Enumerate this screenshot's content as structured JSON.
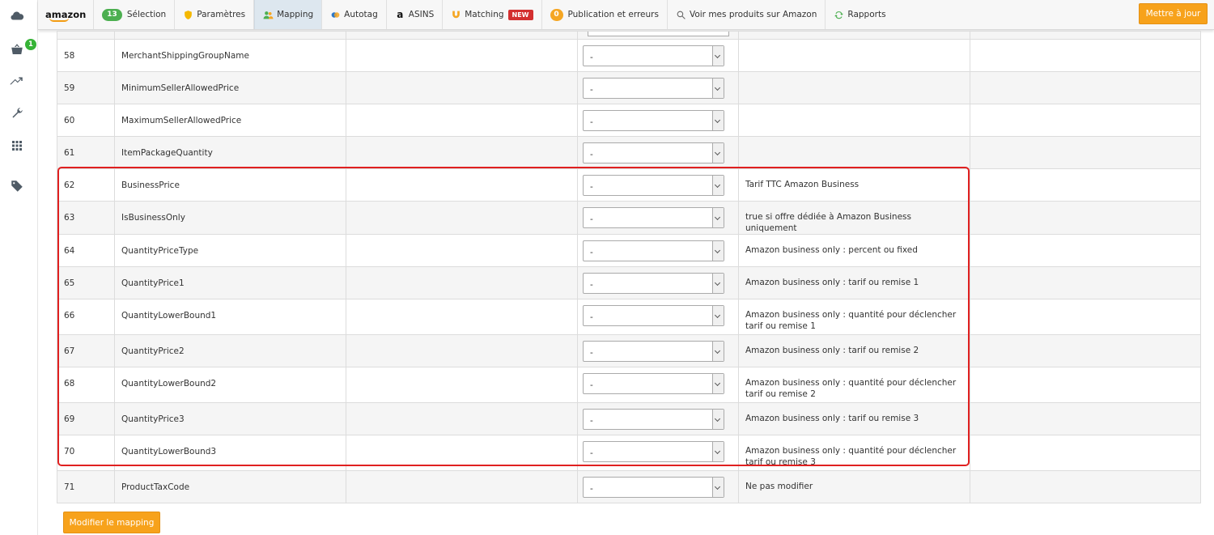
{
  "nav": {
    "logo": "amazon",
    "selection": {
      "count": "13",
      "label": "Sélection"
    },
    "parametres": "Paramètres",
    "mapping": "Mapping",
    "autotag": "Autotag",
    "asins": "ASINS",
    "matching": {
      "label": "Matching",
      "badge": "NEW"
    },
    "publication": {
      "count": "0",
      "label": "Publication et erreurs"
    },
    "voir": "Voir mes produits sur Amazon",
    "rapports": "Rapports",
    "update_label": "Mettre à jour"
  },
  "sidebar": {
    "cart_badge": "1"
  },
  "rows": [
    {
      "num": "58",
      "field": "MerchantShippingGroupName",
      "select": "-",
      "desc": "",
      "tall": false
    },
    {
      "num": "59",
      "field": "MinimumSellerAllowedPrice",
      "select": "-",
      "desc": "",
      "tall": false
    },
    {
      "num": "60",
      "field": "MaximumSellerAllowedPrice",
      "select": "-",
      "desc": "",
      "tall": false
    },
    {
      "num": "61",
      "field": "ItemPackageQuantity",
      "select": "-",
      "desc": "",
      "tall": false
    },
    {
      "num": "62",
      "field": "BusinessPrice",
      "select": "-",
      "desc": "Tarif TTC Amazon Business",
      "tall": false
    },
    {
      "num": "63",
      "field": "IsBusinessOnly",
      "select": "-",
      "desc": "true si offre dédiée à Amazon Business uniquement",
      "tall": false
    },
    {
      "num": "64",
      "field": "QuantityPriceType",
      "select": "-",
      "desc": "Amazon business only : percent ou fixed",
      "tall": false
    },
    {
      "num": "65",
      "field": "QuantityPrice1",
      "select": "-",
      "desc": "Amazon business only : tarif ou remise 1",
      "tall": false
    },
    {
      "num": "66",
      "field": "QuantityLowerBound1",
      "select": "-",
      "desc": "Amazon business only : quantité pour déclencher tarif ou remise 1",
      "tall": true
    },
    {
      "num": "67",
      "field": "QuantityPrice2",
      "select": "-",
      "desc": "Amazon business only : tarif ou remise 2",
      "tall": false
    },
    {
      "num": "68",
      "field": "QuantityLowerBound2",
      "select": "-",
      "desc": "Amazon business only : quantité pour déclencher tarif ou remise 2",
      "tall": true
    },
    {
      "num": "69",
      "field": "QuantityPrice3",
      "select": "-",
      "desc": "Amazon business only : tarif ou remise 3",
      "tall": false
    },
    {
      "num": "70",
      "field": "QuantityLowerBound3",
      "select": "-",
      "desc": "Amazon business only : quantité pour déclencher tarif ou remise 3",
      "tall": true
    },
    {
      "num": "71",
      "field": "ProductTaxCode",
      "select": "-",
      "desc": "Ne pas modifier",
      "tall": false
    }
  ],
  "footer": {
    "modify_label": "Modifier le mapping"
  },
  "colors": {
    "accent": "#f7a21b",
    "highlight": "#e02020",
    "badge_green": "#4caf50",
    "badge_red": "#d32f2f"
  }
}
